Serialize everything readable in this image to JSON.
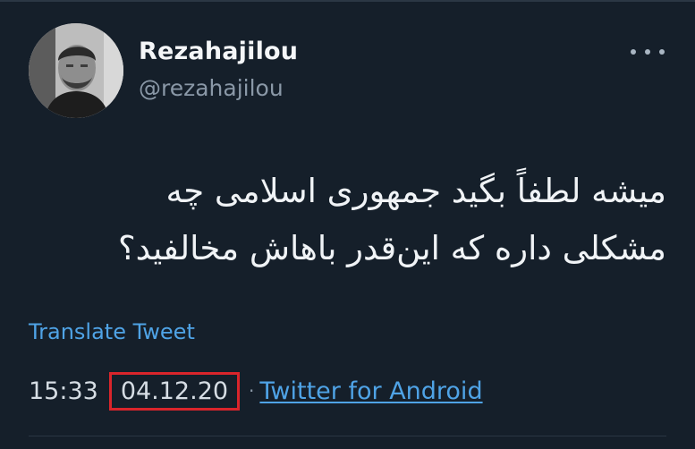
{
  "author": {
    "display_name": "Rezahajilou",
    "handle": "@rezahajilou",
    "avatar_icon": "user-avatar-photo"
  },
  "menu": {
    "more_icon": "ellipsis-horizontal-icon"
  },
  "tweet": {
    "line1": "میشه لطفاً بگید جمهوری اسلامی چه",
    "line2": "مشکلی داره که این‌قدر باهاش مخالفید؟",
    "translate_label": "Translate Tweet",
    "time": "15:33",
    "date": "04.12.20",
    "separator": "·",
    "source": "Twitter for Android"
  },
  "colors": {
    "background": "#151f2a",
    "link": "#4fa3e6",
    "highlight_box": "#d9252b",
    "secondary_text": "#8a98a7"
  }
}
